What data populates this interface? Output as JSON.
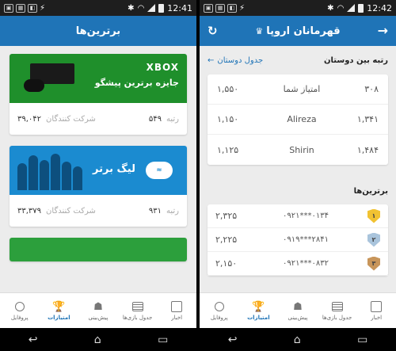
{
  "left": {
    "status": {
      "time": "12:41"
    },
    "appbar": {
      "title": "برترین‌ها"
    },
    "cards": [
      {
        "brand": "XBOX",
        "title": "جایزه برترین پیشگو",
        "rank_label": "رتبه",
        "rank": "۵۴۹",
        "participants_label": "شرکت کنندگان",
        "participants": "۳۹,۰۴۲"
      },
      {
        "brand": "Persian Gulf Cup",
        "title": "لیگ برتر",
        "rank_label": "رتبه",
        "rank": "۹۳۱",
        "participants_label": "شرکت کنندگان",
        "participants": "۳۳,۳۷۹"
      }
    ]
  },
  "right": {
    "status": {
      "time": "12:42"
    },
    "appbar": {
      "title": "قهرمانان اروپا"
    },
    "friends": {
      "title": "رتبه بین دوستان",
      "link": "جدول دوستان",
      "rows": [
        {
          "rank": "۳۰۸",
          "name": "امتیاز شما",
          "score": "۱,۵۵۰"
        },
        {
          "rank": "۱,۳۴۱",
          "name": "Alireza",
          "score": "۱,۱۵۰"
        },
        {
          "rank": "۱,۴۸۴",
          "name": "Shirin",
          "score": "۱,۱۲۵"
        }
      ]
    },
    "leaderboard": {
      "title": "برترین‌ها",
      "rows": [
        {
          "medal": "۱",
          "phone": "۰۹۲۱***۰۱۳۴",
          "score": "۲,۳۲۵",
          "color": "#f1c232"
        },
        {
          "medal": "۲",
          "phone": "۰۹۱۹***۲۸۴۱",
          "score": "۲,۲۲۵",
          "color": "#a9c4dc"
        },
        {
          "medal": "۳",
          "phone": "۰۹۲۱***۰۸۳۲",
          "score": "۲,۱۵۰",
          "color": "#c8955a"
        }
      ]
    }
  },
  "nav": {
    "items": [
      {
        "label": "اخبار",
        "icon": "news-icon"
      },
      {
        "label": "جدول بازی‌ها",
        "icon": "table-icon"
      },
      {
        "label": "پیش‌بینی",
        "icon": "predict-icon"
      },
      {
        "label": "امتیازات",
        "icon": "trophy-icon"
      },
      {
        "label": "پروفایل",
        "icon": "profile-icon"
      }
    ]
  },
  "colors": {
    "primary": "#1f74b7",
    "xbox_green": "#1f8f2b",
    "league_blue": "#1b8bd0"
  }
}
